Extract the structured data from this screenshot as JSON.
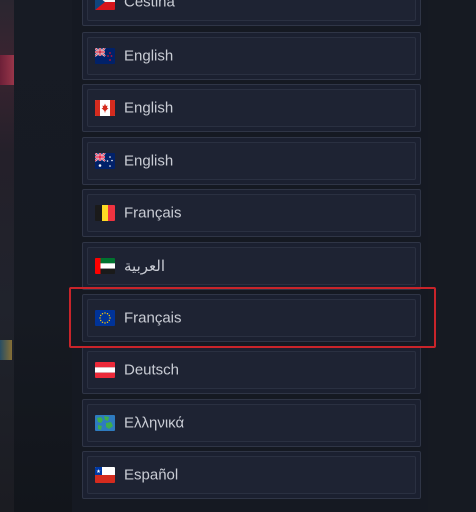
{
  "languages": [
    {
      "label": "Čeština",
      "flag": "czech-flag-icon"
    },
    {
      "label": "English",
      "flag": "new-zealand-flag-icon"
    },
    {
      "label": "English",
      "flag": "canada-flag-icon"
    },
    {
      "label": "English",
      "flag": "australia-flag-icon"
    },
    {
      "label": "Français",
      "flag": "belgium-flag-icon"
    },
    {
      "label": "العربية",
      "flag": "uae-flag-icon"
    },
    {
      "label": "Français",
      "flag": "eu-flag-icon",
      "selected": true
    },
    {
      "label": "Deutsch",
      "flag": "austria-flag-icon"
    },
    {
      "label": "Ελληνικά",
      "flag": "world-flag-icon"
    },
    {
      "label": "Español",
      "flag": "chile-flag-icon"
    }
  ],
  "colors": {
    "selection_outline": "#c8242a",
    "item_background": "#1b2030",
    "text": "#c9ccd4"
  }
}
